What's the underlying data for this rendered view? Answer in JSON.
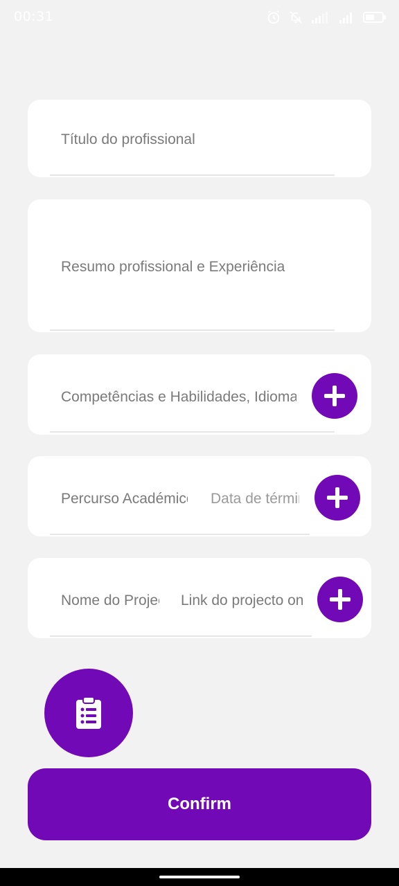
{
  "status_bar": {
    "time": "00:31",
    "icons": [
      "alarm-icon",
      "notifications-off-icon",
      "signal-icon",
      "signal-icon",
      "battery-icon"
    ]
  },
  "form": {
    "title_field": {
      "placeholder": "Título do profissional"
    },
    "summary_field": {
      "placeholder": "Resumo profissional e  Experiência"
    },
    "skills_field": {
      "placeholder": "Competências e Habilidades, Idiomas"
    },
    "education": {
      "course_placeholder": "Percurso Académico",
      "end_date_placeholder": "Data de término"
    },
    "project": {
      "name_placeholder": "Nome do Projecto",
      "link_placeholder": "Link do projecto online"
    }
  },
  "fab": {
    "icon": "clipboard-list-icon"
  },
  "confirm_button": {
    "label": "Confirm"
  },
  "colors": {
    "accent": "#7209b7",
    "background": "#f2f2f2",
    "card": "#ffffff",
    "placeholder": "#7a7a7a"
  }
}
